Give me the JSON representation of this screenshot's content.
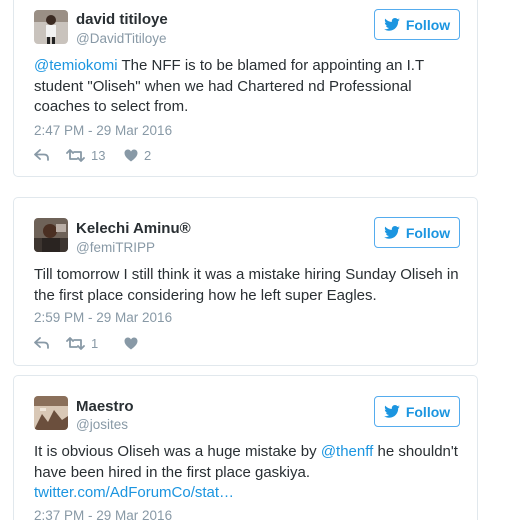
{
  "tweets": [
    {
      "name": "david titiloye",
      "handle": "@DavidTitiloye",
      "follow_label": "Follow",
      "text_mention": "@temiokomi",
      "text_body": " The NFF is to be blamed for appointing an I.T student \"Oliseh\" when we had Chartered nd Professional coaches to select from.",
      "time": "2:47 PM - 29 Mar 2016",
      "retweets": "13",
      "likes": "2",
      "avatar_icon": "user-photo"
    },
    {
      "name": "Kelechi Aminu®",
      "handle": "@femiTRIPP",
      "follow_label": "Follow",
      "text_body": "Till tomorrow I still think it was a mistake hiring Sunday Oliseh in the first place considering how he left super Eagles.",
      "time": "2:59 PM - 29 Mar 2016",
      "retweets": "1",
      "likes": "",
      "avatar_icon": "user-photo"
    },
    {
      "name": "Maestro",
      "handle": "@josites",
      "follow_label": "Follow",
      "text_pre": "It is obvious Oliseh was a huge mistake by ",
      "text_mention": "@thenff",
      "text_post": " he shouldn't have been hired in the first place gaskiya.",
      "text_link": "twitter.com/AdForumCo/stat…",
      "time": "2:37 PM - 29 Mar 2016",
      "avatar_icon": "user-photo"
    }
  ],
  "colors": {
    "accent": "#1b95e0",
    "muted": "#8899a6",
    "border": "#e1e8ed"
  }
}
